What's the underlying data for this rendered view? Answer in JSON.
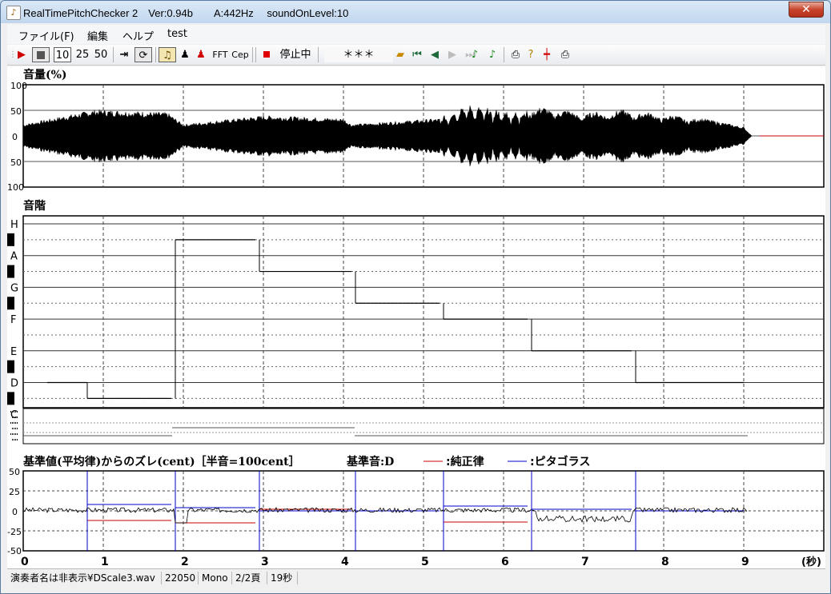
{
  "window": {
    "title": "RealTimePitchChecker 2　Ver:0.94b　　A:442Hz　 soundOnLevel:10",
    "close": "✕"
  },
  "menu": [
    "ファイル(F)",
    "編集",
    "ヘルプ",
    "test"
  ],
  "toolbar": {
    "speed1": "10",
    "speed2": "25",
    "speed3": "50",
    "fft": "FFT",
    "cep": "Cep",
    "status": "停止中",
    "display": "＊＊＊"
  },
  "volume": {
    "title": "音量(%)",
    "yticks": [
      "100",
      "50",
      "0",
      "50",
      "100"
    ]
  },
  "scale": {
    "title": "音階",
    "notes": [
      "H",
      "A",
      "G",
      "F",
      "E",
      "D",
      "C"
    ]
  },
  "deviation": {
    "title": "基準値(平均律)からのズレ(cent)［半音=100cent］",
    "base": "基準音:D",
    "legend_just": ":純正律",
    "legend_pyth": ":ピタゴラス",
    "yticks": [
      "50",
      "25",
      "0",
      "-25",
      "-50"
    ],
    "just_color": "#cc0000",
    "pyth_color": "#0000cc"
  },
  "xaxis": {
    "ticks": [
      "0",
      "1",
      "2",
      "3",
      "4",
      "5",
      "6",
      "7",
      "8",
      "9"
    ],
    "unit": "(秒)"
  },
  "status": {
    "file": "演奏者名は非表示¥DScale3.wav",
    "rate": "22050",
    "channel": "Mono",
    "page": "2/2頁",
    "length": "19秒"
  },
  "chart_data": [
    {
      "type": "area",
      "title": "音量(%)",
      "x_range": [
        0,
        10
      ],
      "ylim": [
        -100,
        100
      ],
      "segments_seconds": [
        [
          0,
          2.0
        ],
        [
          2.0,
          4.1
        ],
        [
          4.1,
          5.2
        ],
        [
          5.2,
          6.3
        ],
        [
          6.3,
          9.0
        ]
      ],
      "envelope_percent_approx": [
        [
          0,
          20
        ],
        [
          0.9,
          45
        ],
        [
          1.8,
          40
        ],
        [
          2.0,
          20
        ],
        [
          3.0,
          35
        ],
        [
          4.0,
          30
        ],
        [
          4.1,
          20
        ],
        [
          5.2,
          30
        ],
        [
          5.5,
          55
        ],
        [
          6.2,
          40
        ],
        [
          6.5,
          50
        ],
        [
          7.0,
          40
        ],
        [
          7.5,
          45
        ],
        [
          8.5,
          30
        ],
        [
          9.0,
          15
        ],
        [
          9.1,
          0
        ]
      ],
      "grid": true
    },
    {
      "type": "line",
      "title": "音階",
      "categories": [
        "C",
        "D",
        "E",
        "F",
        "G",
        "A",
        "H"
      ],
      "steps": [
        {
          "x": [
            0.3,
            0.8
          ],
          "note": "D"
        },
        {
          "x": [
            0.8,
            1.85
          ],
          "note": "C#"
        },
        {
          "x": [
            1.9,
            2.9
          ],
          "note": "H"
        },
        {
          "x": [
            2.95,
            4.1
          ],
          "note": "A"
        },
        {
          "x": [
            4.15,
            5.2
          ],
          "note": "G"
        },
        {
          "x": [
            5.25,
            6.3
          ],
          "note": "F#"
        },
        {
          "x": [
            6.35,
            7.6
          ],
          "note": "E"
        },
        {
          "x": [
            7.65,
            9.0
          ],
          "note": "D"
        }
      ]
    },
    {
      "type": "line",
      "title": "基準値(平均律)からのズレ(cent)［半音=100cent］",
      "ylim": [
        -50,
        50
      ],
      "series": [
        {
          "name": "純正律",
          "segments": [
            [
              0.8,
              1.85,
              -12
            ],
            [
              1.9,
              2.9,
              -15
            ],
            [
              2.95,
              4.1,
              2
            ],
            [
              4.15,
              5.2,
              0
            ],
            [
              5.25,
              6.3,
              -14
            ],
            [
              6.35,
              7.6,
              2
            ],
            [
              7.65,
              9.0,
              0
            ]
          ]
        },
        {
          "name": "ピタゴラス",
          "segments": [
            [
              0.8,
              1.85,
              8
            ],
            [
              1.9,
              2.9,
              4
            ],
            [
              2.95,
              4.1,
              0
            ],
            [
              4.15,
              5.2,
              0
            ],
            [
              5.25,
              6.3,
              6
            ],
            [
              6.35,
              7.6,
              2
            ],
            [
              7.65,
              9.0,
              0
            ]
          ]
        }
      ]
    }
  ]
}
